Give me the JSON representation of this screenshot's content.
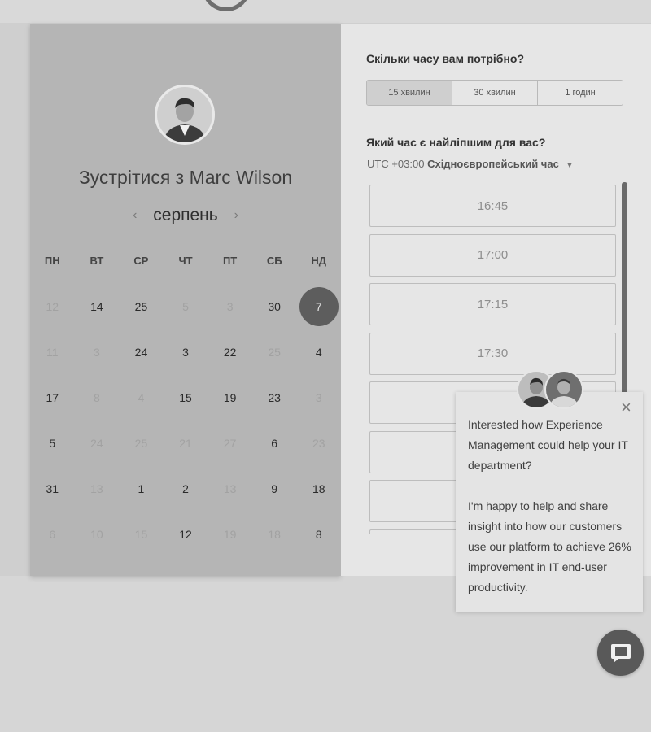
{
  "booking": {
    "title_prefix": "Зустрітися з",
    "host_name": "Marc Wilson",
    "month": "серпень",
    "prev_arrow": "‹",
    "next_arrow": "›",
    "weekdays": [
      "ПН",
      "ВТ",
      "СР",
      "ЧТ",
      "ПТ",
      "СБ",
      "НД"
    ],
    "weeks": [
      [
        {
          "d": "12",
          "m": true
        },
        {
          "d": "14",
          "m": false
        },
        {
          "d": "25",
          "m": false
        },
        {
          "d": "5",
          "m": true
        },
        {
          "d": "3",
          "m": true
        },
        {
          "d": "30",
          "m": false
        },
        {
          "d": "7",
          "m": false,
          "s": true
        }
      ],
      [
        {
          "d": "11",
          "m": true
        },
        {
          "d": "3",
          "m": true
        },
        {
          "d": "24",
          "m": false
        },
        {
          "d": "3",
          "m": false
        },
        {
          "d": "22",
          "m": false
        },
        {
          "d": "25",
          "m": true
        },
        {
          "d": "4",
          "m": false
        }
      ],
      [
        {
          "d": "17",
          "m": false
        },
        {
          "d": "8",
          "m": true
        },
        {
          "d": "4",
          "m": true
        },
        {
          "d": "15",
          "m": false
        },
        {
          "d": "19",
          "m": false
        },
        {
          "d": "23",
          "m": false
        },
        {
          "d": "3",
          "m": true
        }
      ],
      [
        {
          "d": "5",
          "m": false
        },
        {
          "d": "24",
          "m": true
        },
        {
          "d": "25",
          "m": true
        },
        {
          "d": "21",
          "m": true
        },
        {
          "d": "27",
          "m": true
        },
        {
          "d": "6",
          "m": false
        },
        {
          "d": "23",
          "m": true
        }
      ],
      [
        {
          "d": "31",
          "m": false
        },
        {
          "d": "13",
          "m": true
        },
        {
          "d": "1",
          "m": false
        },
        {
          "d": "2",
          "m": false
        },
        {
          "d": "13",
          "m": true
        },
        {
          "d": "9",
          "m": false
        },
        {
          "d": "18",
          "m": false
        }
      ],
      [
        {
          "d": "6",
          "m": true
        },
        {
          "d": "10",
          "m": true
        },
        {
          "d": "15",
          "m": true
        },
        {
          "d": "12",
          "m": false
        },
        {
          "d": "19",
          "m": true
        },
        {
          "d": "18",
          "m": true
        },
        {
          "d": "8",
          "m": false
        }
      ]
    ]
  },
  "scheduler": {
    "duration_question": "Скільки часу вам потрібно?",
    "durations": [
      {
        "label": "15 хвилин",
        "active": true
      },
      {
        "label": "30 хвилин",
        "active": false
      },
      {
        "label": "1 годин",
        "active": false
      }
    ],
    "time_question": "Який час є найліпшим для вас?",
    "timezone_offset": "UTC +03:00",
    "timezone_name": "Східноєвропейський час",
    "slots": [
      "16:45",
      "17:00",
      "17:15",
      "17:30",
      "",
      "",
      "",
      ""
    ]
  },
  "chat": {
    "close_symbol": "×",
    "message_1": "Interested how Experience Management could help your IT department?",
    "message_2": "I'm happy to help and share insight into how our customers use our platform to achieve 26% improvement in IT end-user productivity.",
    "launcher_icon": "chat-bubble-icon"
  },
  "colors": {
    "selected_day": "#5d5d5d",
    "left_panel": "#b5b5b5",
    "right_panel": "#e6e6e6"
  }
}
